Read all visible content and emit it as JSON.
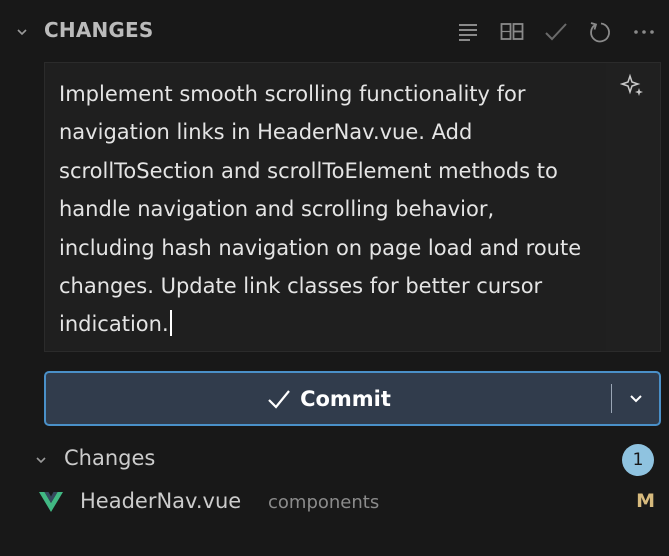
{
  "header": {
    "title": "CHANGES",
    "toolbar": [
      {
        "icon": "list-icon"
      },
      {
        "icon": "tree-view-icon"
      },
      {
        "icon": "check-icon"
      },
      {
        "icon": "refresh-icon"
      },
      {
        "icon": "more-icon"
      }
    ]
  },
  "commit_message": {
    "text": "Implement smooth scrolling functionality for navigation links in HeaderNav.vue. Add scrollToSection and scrollToElement methods to handle navigation and scrolling behavior, including hash navigation on page load and route changes. Update link classes for better cursor indication.",
    "sparkle_icon": "sparkle-icon"
  },
  "commit_button": {
    "label": "Commit",
    "icon": "check-icon",
    "dropdown_icon": "chevron-down-icon"
  },
  "changes_group": {
    "label": "Changes",
    "count": "1"
  },
  "files": [
    {
      "name": "HeaderNav.vue",
      "folder": "components",
      "status": "M",
      "icon": "vue-icon"
    }
  ],
  "colors": {
    "background": "#181818",
    "accent_border": "#4a90c8",
    "commit_bg": "#313c4c",
    "badge": "#8fc3e0",
    "modified": "#d7ba7d",
    "vue_green": "#41b883"
  }
}
